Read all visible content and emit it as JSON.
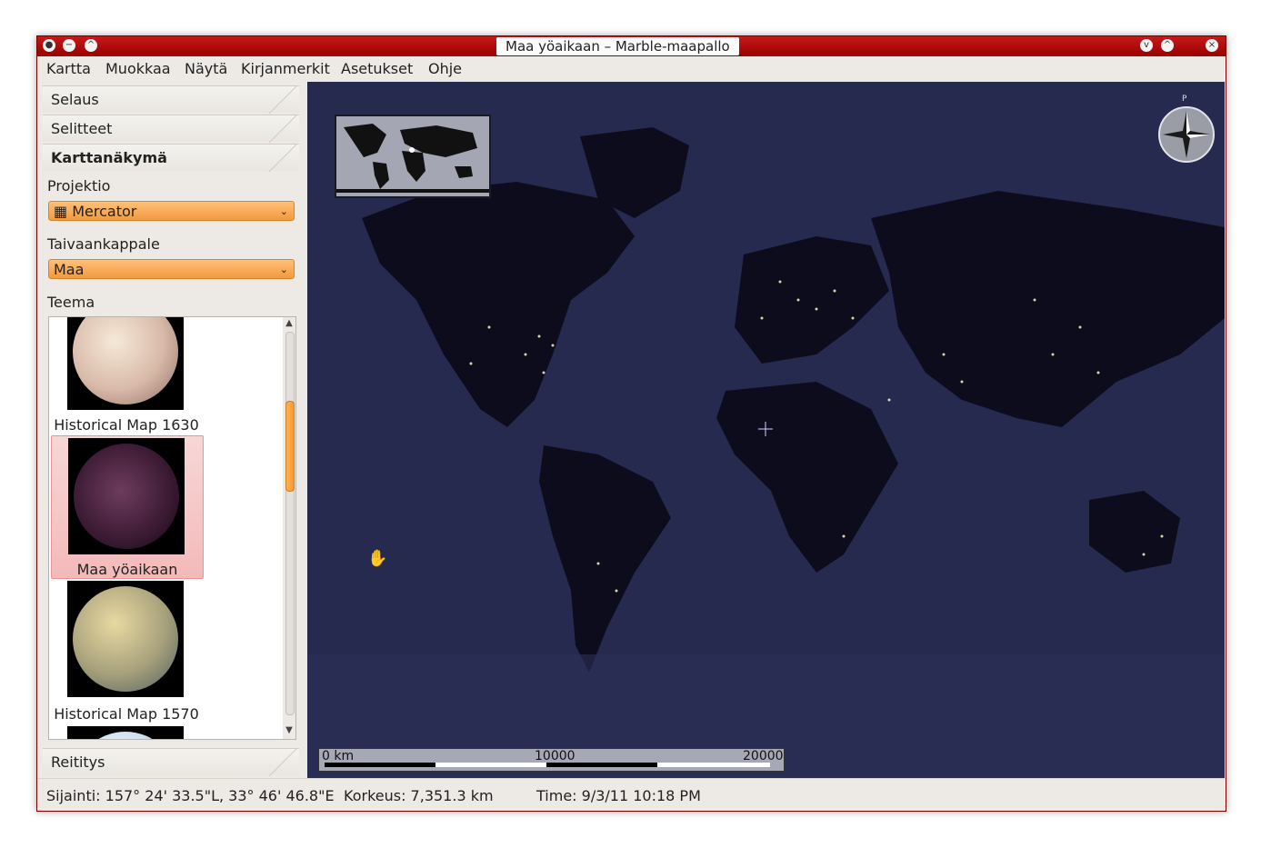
{
  "window": {
    "title": "Maa yöaikaan – Marble-maapallo",
    "buttons": [
      "−",
      "^",
      "v",
      "^",
      "×"
    ]
  },
  "menu": {
    "items": [
      "Kartta",
      "Muokkaa",
      "Näytä",
      "Kirjanmerkit",
      "Asetukset",
      "Ohje"
    ]
  },
  "sidebar": {
    "tabs": [
      "Selaus",
      "Selitteet",
      "Karttanäkymä",
      "Reititys"
    ],
    "projection_label": "Projektio",
    "projection_value": "Mercator",
    "celestial_label": "Taivaankappale",
    "celestial_value": "Maa",
    "theme_label": "Teema",
    "themes": [
      {
        "name": "Historical Map 1630",
        "selected": false
      },
      {
        "name": "Maa yöaikaan",
        "selected": true
      },
      {
        "name": "Historical Map 1570",
        "selected": false
      }
    ]
  },
  "map": {
    "scale": {
      "start": "0 km",
      "mid": "10000",
      "end": "20000"
    },
    "compass_label": "P"
  },
  "status": {
    "location": "Sijainti: 157° 24' 33.5\"L,  33° 46' 46.8\"E",
    "altitude": "Korkeus:  7,351.3 km",
    "time": "Time: 9/3/11 10:18 PM"
  },
  "colors": {
    "title_bar": "#b80e0e",
    "accent": "#f39a3d",
    "map_ocean": "#262a4e",
    "map_land": "#0c0c1c"
  }
}
